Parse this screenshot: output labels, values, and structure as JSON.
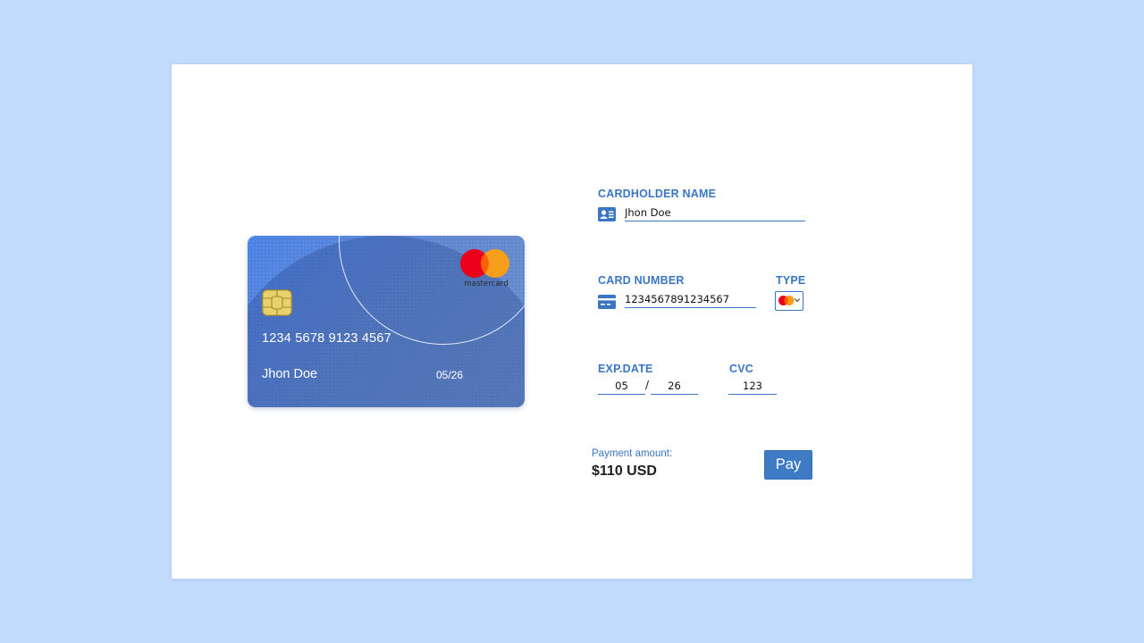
{
  "card_preview": {
    "number": "1234 5678 9123 4567",
    "holder": "Jhon Doe",
    "expiry": "05/26",
    "brand_word": "mastercard"
  },
  "form": {
    "cardholder_label": "CARDHOLDER NAME",
    "cardholder_value": "Jhon Doe",
    "card_number_label": "CARD NUMBER",
    "card_number_value": "1234567891234567",
    "type_label": "TYPE",
    "type_selected": "mastercard",
    "exp_label": "EXP.DATE",
    "exp_month": "05",
    "exp_separator": "/",
    "exp_year": "26",
    "cvc_label": "CVC",
    "cvc_value": "123"
  },
  "payment": {
    "amount_label": "Payment amount:",
    "amount_value": "$110 USD",
    "pay_label": "Pay"
  },
  "colors": {
    "page_background": "#c2dbfd",
    "accent": "#3a76c4",
    "card_gradient_start": "#4a82e6",
    "card_gradient_end": "#6d8fc9",
    "mastercard_red": "#eb001b",
    "mastercard_orange": "#f79e1b"
  },
  "icons": {
    "cardholder": "contact-card-icon",
    "card_number": "credit-card-icon",
    "chip": "card-chip-icon",
    "brand": "mastercard-logo-icon",
    "dropdown": "chevron-down-icon"
  }
}
